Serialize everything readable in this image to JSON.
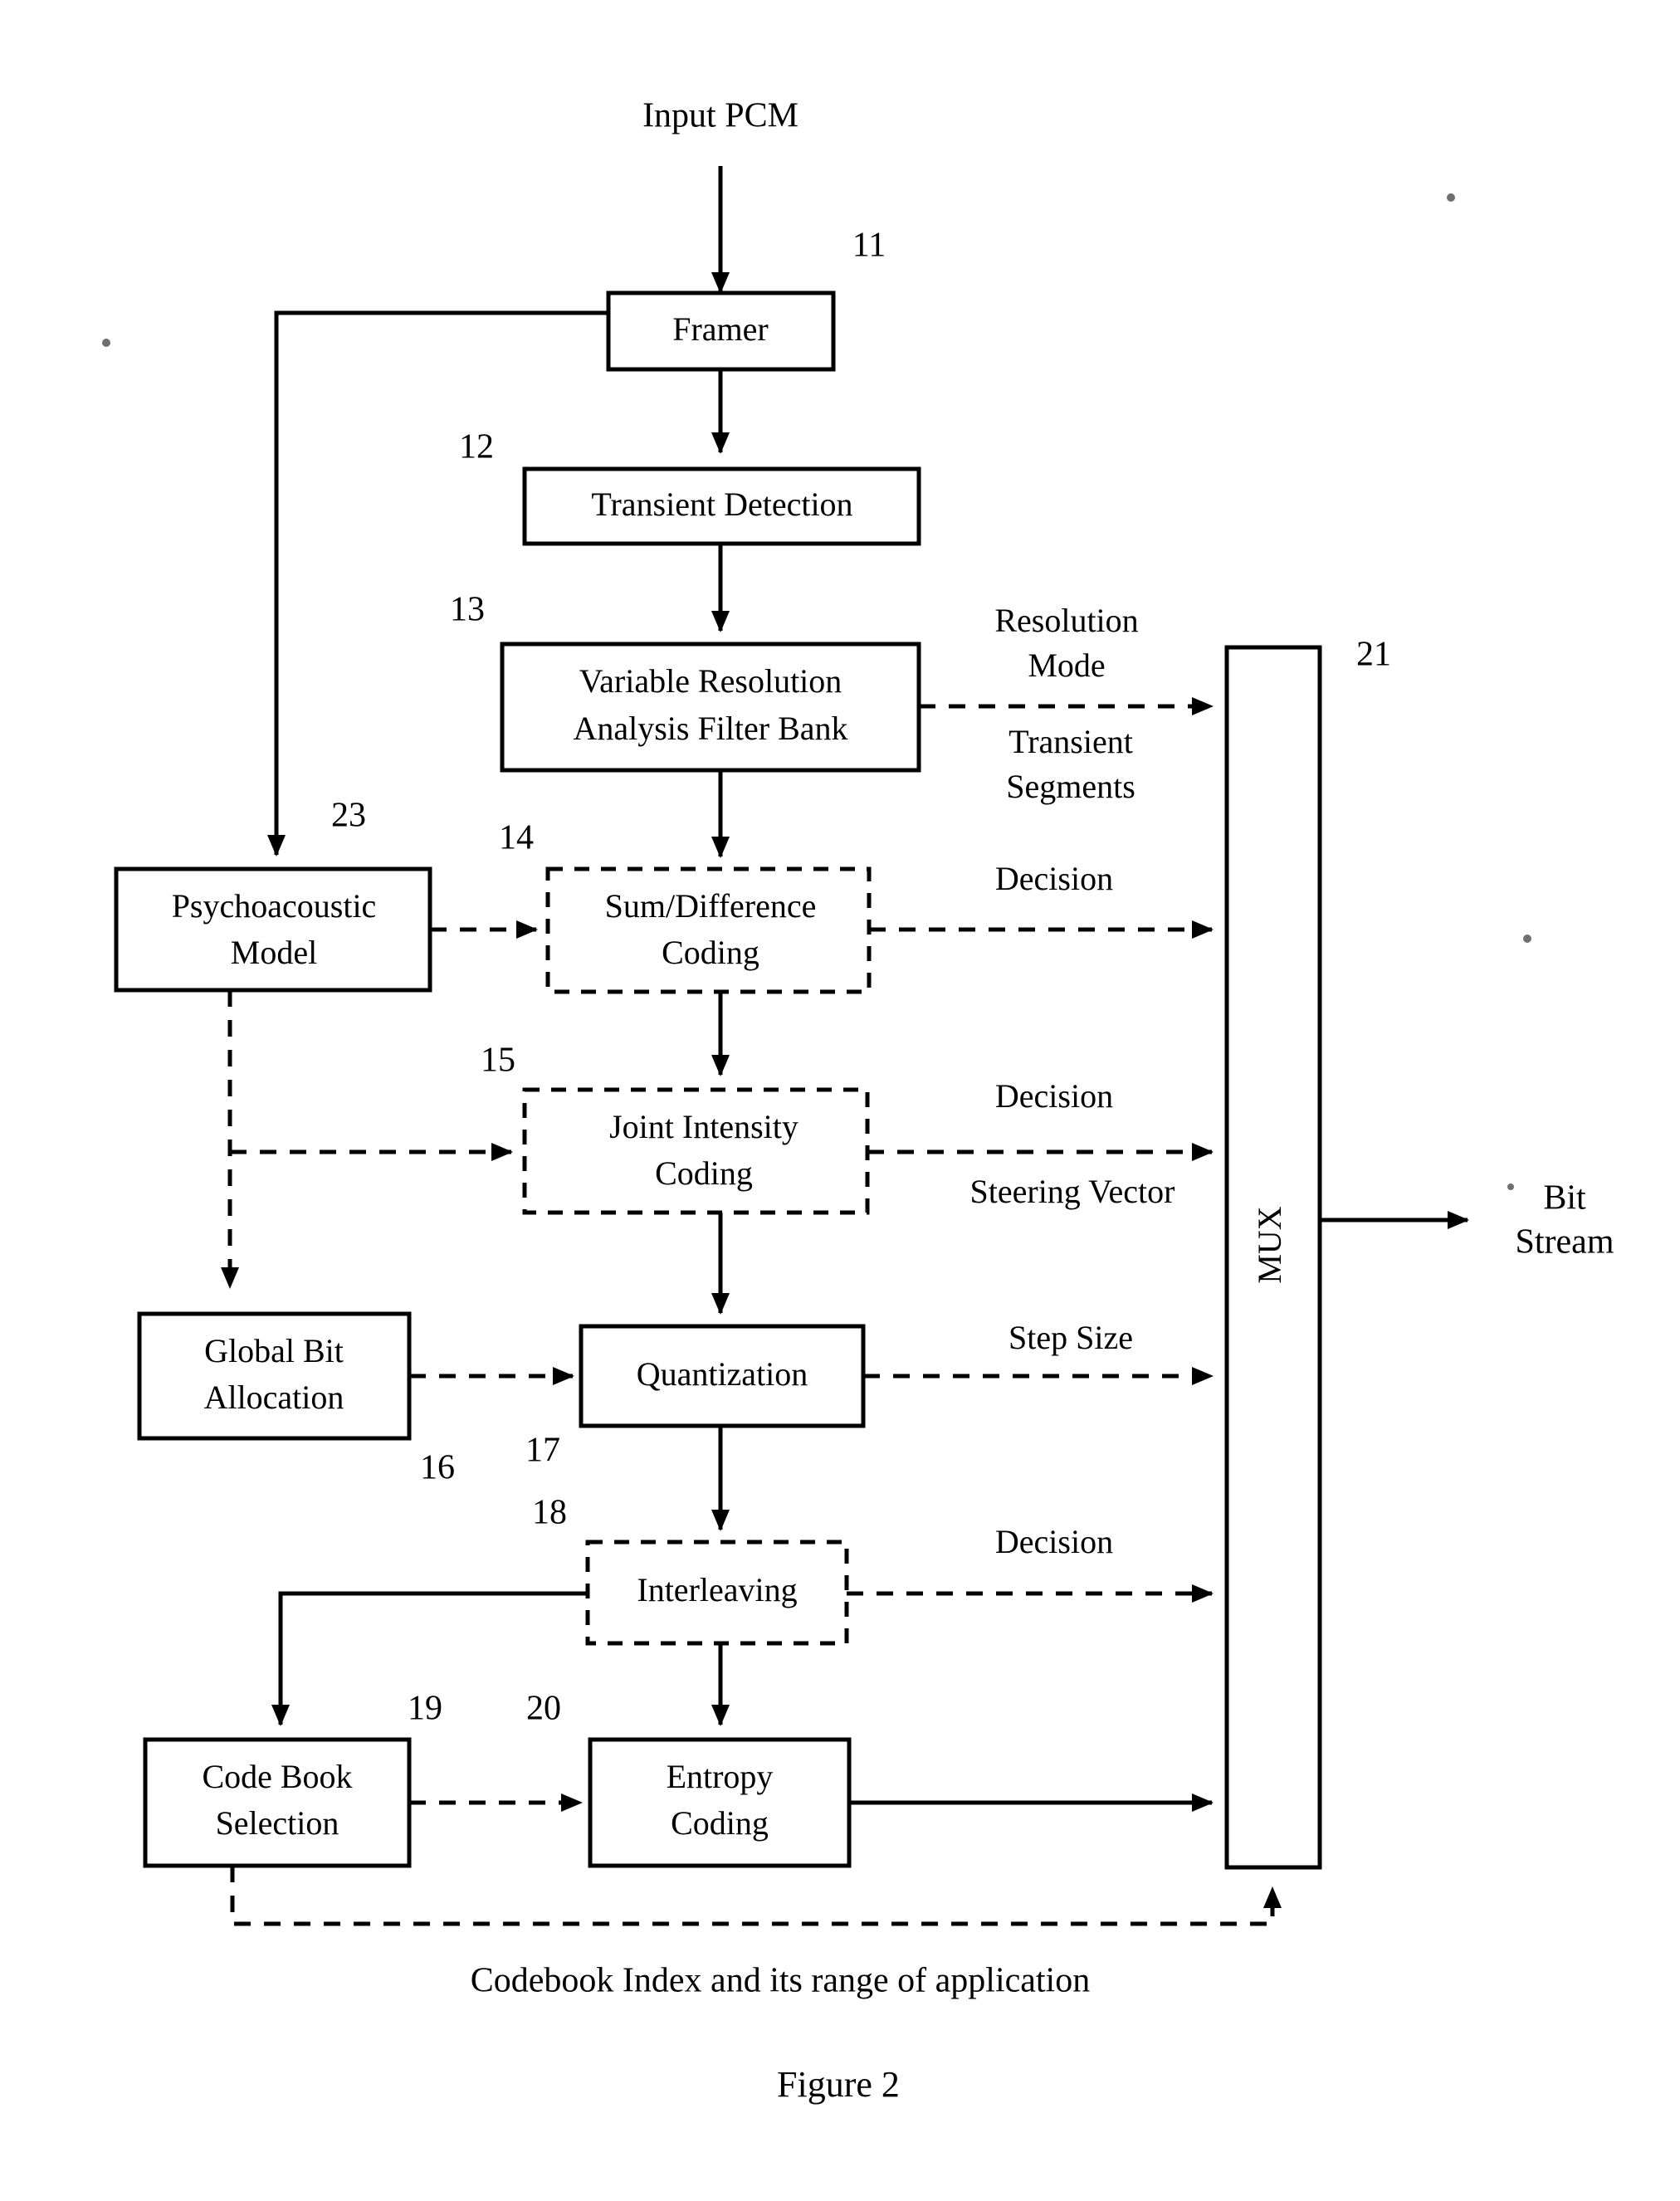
{
  "figure": {
    "caption": "Figure 2",
    "bottom_note": "Codebook Index and its range of application",
    "input_label": "Input PCM",
    "output_label_line1": "Bit",
    "output_label_line2": "Stream"
  },
  "blocks": [
    {
      "id": "framer",
      "ref": "11",
      "label_line1": "Framer",
      "label_line2": "",
      "style": "solid"
    },
    {
      "id": "transient",
      "ref": "12",
      "label_line1": "Transient Detection",
      "label_line2": "",
      "style": "solid"
    },
    {
      "id": "filterbank",
      "ref": "13",
      "label_line1": "Variable Resolution",
      "label_line2": "Analysis Filter Bank",
      "style": "solid"
    },
    {
      "id": "sumdiff",
      "ref": "14",
      "label_line1": "Sum/Difference",
      "label_line2": "Coding",
      "style": "dashed"
    },
    {
      "id": "jointintensity",
      "ref": "15",
      "label_line1": "Joint Intensity",
      "label_line2": "Coding",
      "style": "dashed"
    },
    {
      "id": "globalbit",
      "ref": "16",
      "label_line1": "Global Bit",
      "label_line2": "Allocation",
      "style": "solid"
    },
    {
      "id": "quantization",
      "ref": "17",
      "label_line1": "Quantization",
      "label_line2": "",
      "style": "solid"
    },
    {
      "id": "interleaving",
      "ref": "18",
      "label_line1": "Interleaving",
      "label_line2": "",
      "style": "dashed"
    },
    {
      "id": "codebook",
      "ref": "19",
      "label_line1": "Code Book",
      "label_line2": "Selection",
      "style": "solid"
    },
    {
      "id": "entropy",
      "ref": "20",
      "label_line1": "Entropy",
      "label_line2": "Coding",
      "style": "solid"
    },
    {
      "id": "mux",
      "ref": "21",
      "label_line1": "MUX",
      "label_line2": "",
      "style": "solid"
    },
    {
      "id": "psychoacoustic",
      "ref": "23",
      "label_line1": "Psychoacoustic",
      "label_line2": "Model",
      "style": "solid"
    }
  ],
  "edge_labels": {
    "resolution_mode_line1": "Resolution",
    "resolution_mode_line2": "Mode",
    "transient_segments_line1": "Transient",
    "transient_segments_line2": "Segments",
    "decision_sumdiff": "Decision",
    "decision_joint": "Decision",
    "steering_vector": "Steering Vector",
    "step_size": "Step Size",
    "decision_interleaving": "Decision"
  },
  "colors": {
    "ink": "#000000",
    "paper": "#ffffff"
  }
}
